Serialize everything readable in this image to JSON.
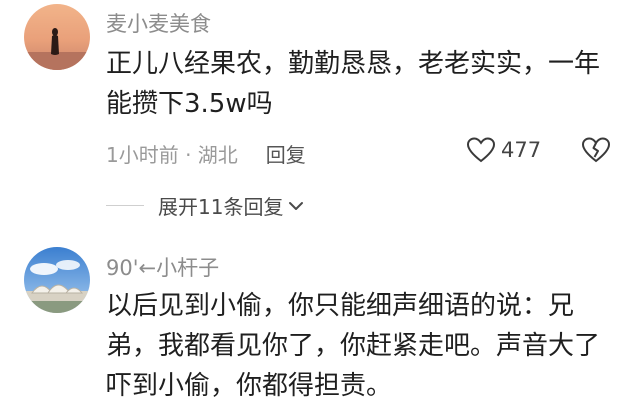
{
  "comments": [
    {
      "avatar_icon": "sunset-silhouette-avatar",
      "username": "麦小麦美食",
      "text": "正儿八经果农，勤勤恳恳，老老实实，一年能攒下3.5w吗",
      "time": "1小时前 · 湖北",
      "reply_label": "回复",
      "like_count": "477",
      "expand_replies": "展开11条回复"
    },
    {
      "avatar_icon": "landscape-building-avatar",
      "username": "90'←小杆子",
      "text": "以后见到小偷，你只能细声细语的说：兄弟，我都看见你了，你赶紧走吧。声音大了吓到小偷，你都得担责。"
    }
  ],
  "icons": {
    "like": "heart-outline-icon",
    "dislike": "broken-heart-icon",
    "expand": "chevron-down-icon"
  }
}
